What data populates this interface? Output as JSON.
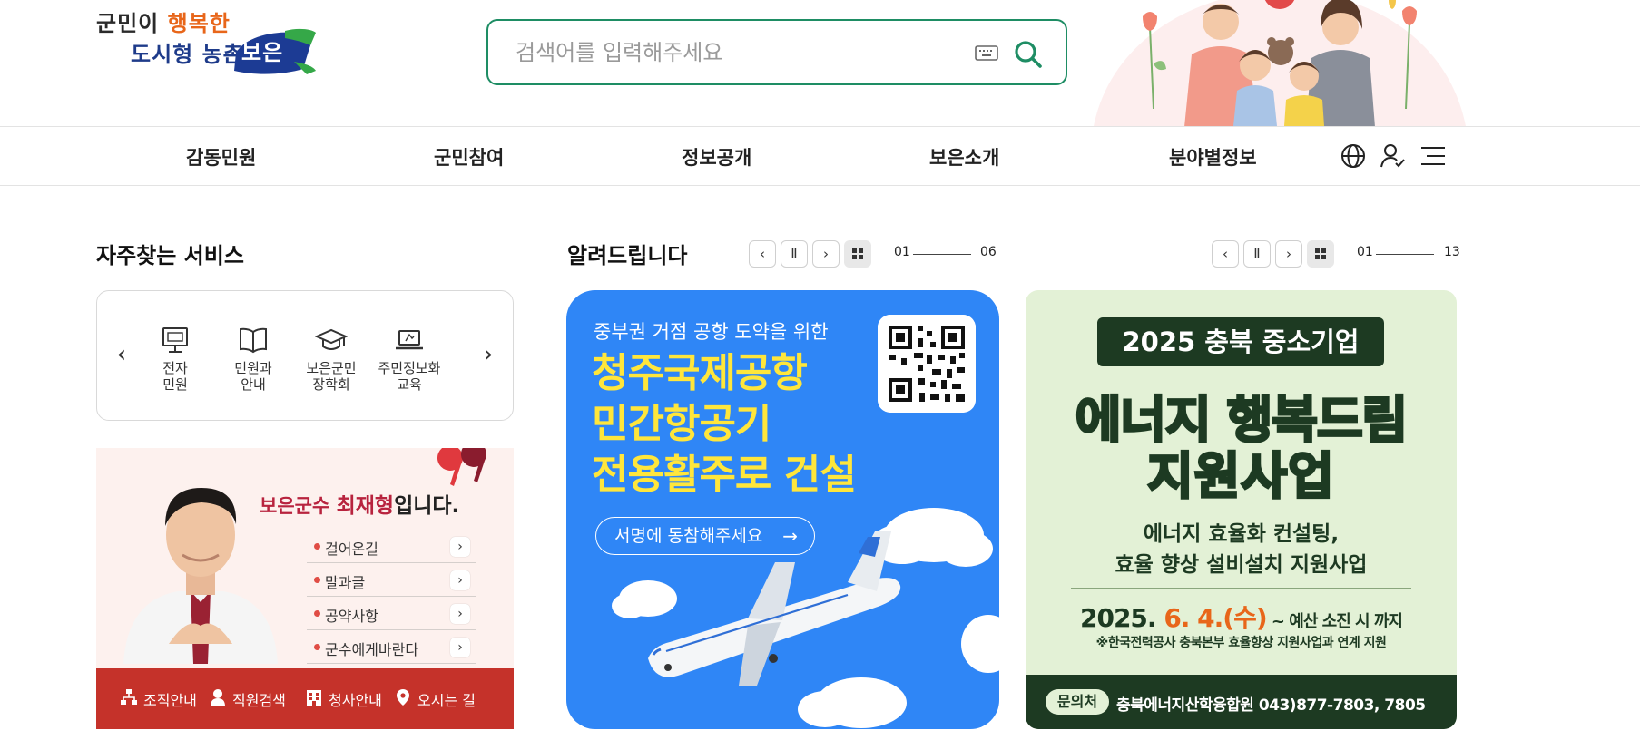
{
  "header": {
    "logo": {
      "line1_prefix": "군민이",
      "line1_highlight": "행복한",
      "line2": "도시형 농촌",
      "line2_brush": "보은"
    },
    "search": {
      "placeholder": "검색어를 입력해주세요"
    }
  },
  "nav": {
    "items": [
      "감동민원",
      "군민참여",
      "정보공개",
      "보은소개",
      "분야별정보"
    ],
    "icons": [
      "globe-icon",
      "user-check-icon",
      "menu-icon"
    ]
  },
  "services": {
    "title": "자주찾는 서비스",
    "items": [
      {
        "label": "전자\n민원",
        "icon": "monitor-icon"
      },
      {
        "label": "민원과\n안내",
        "icon": "book-icon"
      },
      {
        "label": "보은군민\n장학회",
        "icon": "graduation-cap-icon"
      },
      {
        "label": "주민정보화\n교육",
        "icon": "laptop-icon"
      }
    ],
    "prev": "‹",
    "next": "›"
  },
  "mayor": {
    "prefix": "보은군수 ",
    "name": "최재형",
    "suffix": "입니다.",
    "links": [
      "걸어온길",
      "말과글",
      "공약사항",
      "군수에게바란다"
    ],
    "bottom": [
      "조직안내",
      "직원검색",
      "청사안내",
      "오시는 길"
    ]
  },
  "notice": {
    "title": "알려드립니다",
    "pager1": {
      "current": "01",
      "total": "06"
    },
    "pager2": {
      "current": "01",
      "total": "13"
    }
  },
  "banner_blue": {
    "subtitle": "중부권 거점 공항 도약을 위한",
    "headline": "청주국제공항\n민간항공기\n전용활주로 건설",
    "cta": "서명에 동참해주세요",
    "cta_arrow": "→"
  },
  "banner_green": {
    "pill": "2025 충북 중소기업",
    "big1": "에너지 행복드림",
    "big2": "지원사업",
    "desc": "에너지 효율화 컨설팅,\n효율 향상 설비설치 지원사업",
    "date_year": "2025.",
    "date_day": "6. 4.(수)",
    "date_suffix": " ~ 예산 소진 시 까지",
    "note": "※한국전력공사 충북본부 효율향상 지원사업과 연계 지원",
    "tag": "문의처",
    "contact": "충북에너지산학융합원 043)877-7803, 7805"
  },
  "colors": {
    "accent_green": "#1e8d64",
    "mayor_red": "#c5322a",
    "banner_blue": "#2f86f6",
    "banner_green_bg": "#e3f1d6",
    "banner_green_dark": "#1d3a22"
  }
}
